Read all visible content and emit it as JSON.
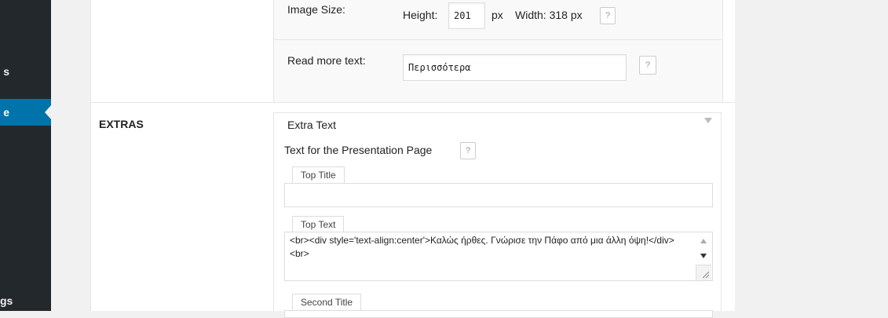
{
  "sidebar": {
    "items": [
      {
        "label": "s"
      },
      {
        "label": "e"
      },
      {
        "label": "gs"
      }
    ]
  },
  "image_size": {
    "label": "Image Size:",
    "height_label": "Height:",
    "height_value": "201",
    "unit": "px",
    "width_text": "Width: 318 px",
    "help": "?"
  },
  "read_more": {
    "label": "Read more text:",
    "value": "Περισσότερα",
    "help": "?"
  },
  "extras": {
    "section_label": "EXTRAS",
    "box_title": "Extra Text",
    "presentation_label": "Text for the Presentation Page",
    "help": "?",
    "top_title": {
      "tab": "Top Title",
      "value": ""
    },
    "top_text": {
      "tab": "Top Text",
      "value": "<br><div style='text-align:center'>Καλώς ήρθες. Γνώρισε την Πάφο από μια άλλη όψη!</div>\n<br>"
    },
    "second_title": {
      "tab": "Second Title"
    }
  }
}
